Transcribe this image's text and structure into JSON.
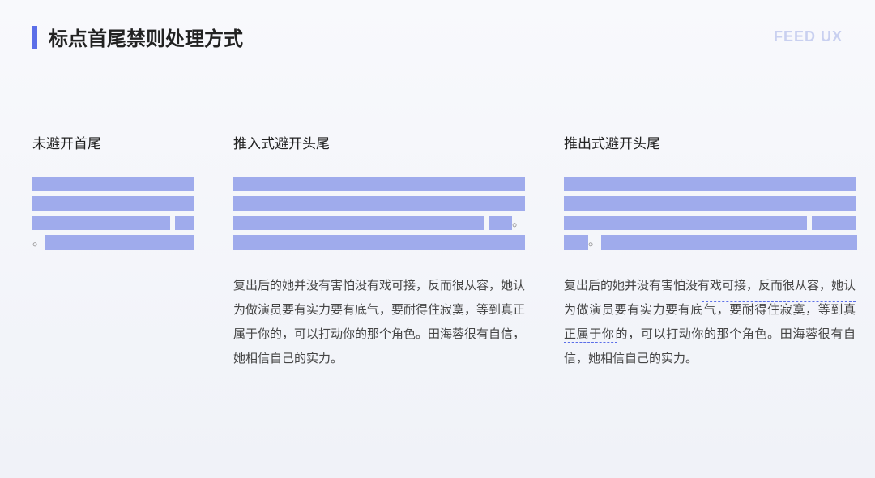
{
  "header": {
    "title": "标点首尾禁则处理方式",
    "brand": "FEED UX"
  },
  "columns": {
    "col1": {
      "label": "未避开首尾"
    },
    "col2": {
      "label": "推入式避开头尾",
      "sample": "复出后的她并没有害怕没有戏可接，反而很从容，她认为做演员要有实力要有底气，要耐得住寂寞，等到真正属于你的，可以打动你的那个角色。田海蓉很有自信，她相信自己的实力。"
    },
    "col3": {
      "label": "推出式避开头尾",
      "sample_part1": "复出后的她并没有害怕没有戏可接，反而很从容，她认为做演员要有实力要有底",
      "sample_highlight": "气，要耐得住寂寞，等到真正属于你",
      "sample_part2": "的，可以打动你的那个角色。田海蓉很有自信，她相信自己的实力。"
    }
  },
  "punct": {
    "period": "。"
  }
}
